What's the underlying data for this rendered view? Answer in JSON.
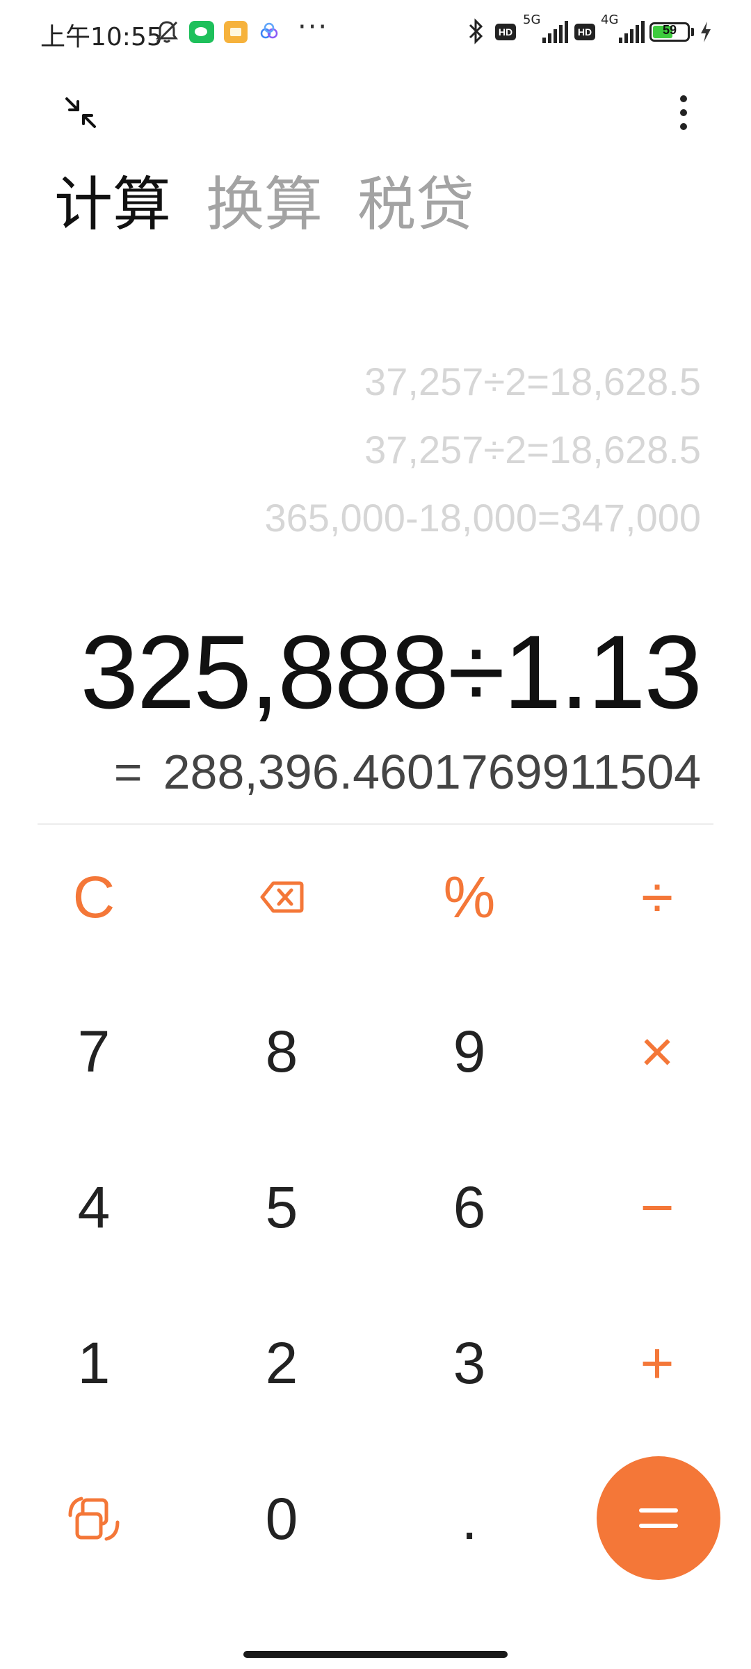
{
  "status_bar": {
    "time": "上午10:55",
    "network_1": "5G",
    "network_2": "4G",
    "hd_1": "HD",
    "hd_2": "HD",
    "battery_level": "59",
    "battery_fraction": 0.59
  },
  "tabs": [
    {
      "label": "计算",
      "active": true
    },
    {
      "label": "换算",
      "active": false
    },
    {
      "label": "税贷",
      "active": false
    }
  ],
  "history": [
    "37,257÷2=18,628.5",
    "37,257÷2=18,628.5",
    "365,000-18,000=347,000"
  ],
  "expression": "325,888÷1.13",
  "result": {
    "equals_sign": "=",
    "value": "288,396.460176991150​4"
  },
  "keypad": {
    "clear": "C",
    "percent": "%",
    "divide": "÷",
    "multiply": "×",
    "minus": "−",
    "plus": "+",
    "decimal": ".",
    "digits": {
      "0": "0",
      "1": "1",
      "2": "2",
      "3": "3",
      "4": "4",
      "5": "5",
      "6": "6",
      "7": "7",
      "8": "8",
      "9": "9"
    }
  },
  "accent_color": "#f47738",
  "icons": [
    "dnd-bell-icon",
    "wechat-icon",
    "notes-icon",
    "cloud-icon",
    "more-dots-icon",
    "bluetooth-icon",
    "signal-icon",
    "battery-icon",
    "charging-icon",
    "collapse-icon",
    "kebab-menu-icon",
    "backspace-icon",
    "switch-mode-icon",
    "equals-icon"
  ]
}
